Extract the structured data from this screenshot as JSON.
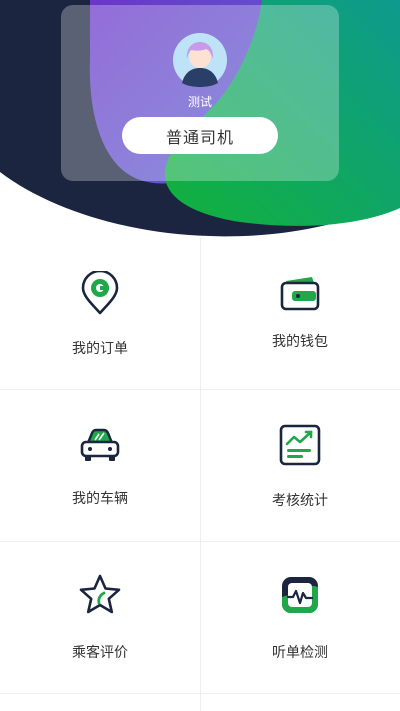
{
  "colors": {
    "accent_green": "#1fa74a",
    "dark_navy": "#1b2540",
    "purple": "#8a5ad6",
    "teal": "#13a58f"
  },
  "profile": {
    "username": "测试",
    "role": "普通司机",
    "avatar_icon": "avatar-icon"
  },
  "menu": [
    {
      "label": "我的订单",
      "icon": "location-pin-icon"
    },
    {
      "label": "我的钱包",
      "icon": "wallet-icon"
    },
    {
      "label": "我的车辆",
      "icon": "car-icon"
    },
    {
      "label": "考核统计",
      "icon": "chart-icon"
    },
    {
      "label": "乘客评价",
      "icon": "star-icon"
    },
    {
      "label": "听单检测",
      "icon": "pulse-icon"
    }
  ]
}
